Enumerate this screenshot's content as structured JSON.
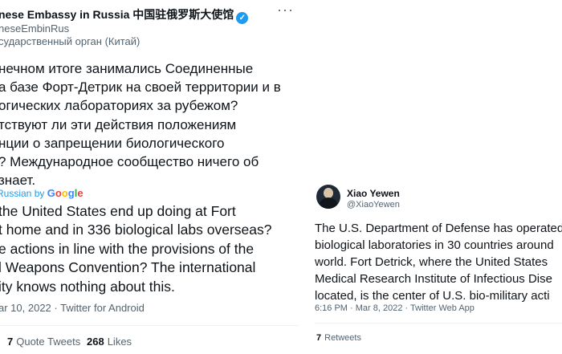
{
  "left_tweet": {
    "display_name": "nese Embassy in Russia 中国驻俄罗斯大使馆",
    "handle": "neseEmbinRus",
    "label": "сударственный орган (Китай)",
    "more_icon": "more-horizontal-icon",
    "text_ru": [
      "нечном итоге занимались Соединенные",
      "а базе Форт-Детрик на своей территории и в",
      "огических лабораториях за рубежом?",
      "тствуют ли эти действия положениям",
      "нции о запрещении биологического",
      "? Международное сообщество ничего об",
      "знает."
    ],
    "translated_from": "Russian by",
    "translator": [
      "G",
      "o",
      "o",
      "g",
      "l",
      "e"
    ],
    "text_en": [
      " the United States end up doing at Fort",
      "t home and in 336 biological labs overseas?",
      "e actions in line with the provisions of the",
      "l Weapons Convention? The international",
      "ity knows nothing about this."
    ],
    "meta": "ar 10, 2022 · Twitter for Android",
    "quote_tweets_count": "7",
    "quote_tweets_label": "Quote Tweets",
    "likes_count": "268",
    "likes_label": "Likes"
  },
  "right_tweet": {
    "display_name": "Xiao Yewen",
    "handle": "@XiaoYewen",
    "text": [
      "The U.S. Department of Defense has operated",
      "biological laboratories in 30 countries around",
      "world. Fort Detrick, where the United States",
      "Medical Research Institute of Infectious Dise",
      "located, is the center of U.S. bio-military acti"
    ],
    "meta": "6:16 PM · Mar 8, 2022 · Twitter Web App",
    "retweets_count": "7",
    "retweets_label": "Retweets"
  },
  "colors": {
    "link": "#1d9bf0",
    "secondary": "#536471",
    "text": "#0f1419"
  }
}
